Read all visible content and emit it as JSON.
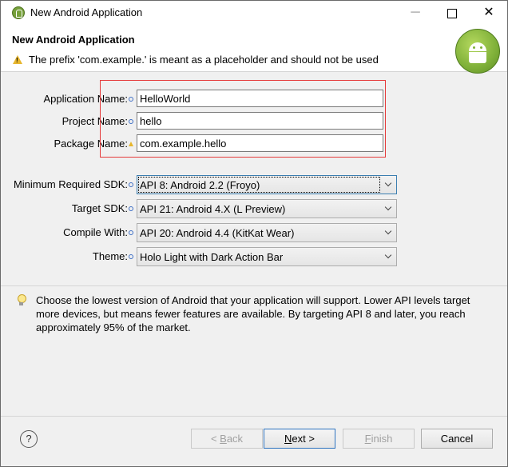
{
  "window": {
    "title": "New Android Application",
    "minimize": "─",
    "close": "✕"
  },
  "banner": {
    "title": "New Android Application",
    "message": "The prefix 'com.example.' is meant as a placeholder and should not be used"
  },
  "form": {
    "app_name": {
      "label": "Application Name:",
      "value": "HelloWorld"
    },
    "project_name": {
      "label": "Project Name:",
      "value": "hello"
    },
    "package_name": {
      "label": "Package Name:",
      "value": "com.example.hello"
    }
  },
  "sdk": {
    "min_sdk": {
      "label": "Minimum Required SDK:",
      "value": "API 8: Android 2.2 (Froyo)"
    },
    "target_sdk": {
      "label": "Target SDK:",
      "value": "API 21: Android 4.X (L Preview)"
    },
    "compile_with": {
      "label": "Compile With:",
      "value": "API 20: Android 4.4 (KitKat Wear)"
    },
    "theme": {
      "label": "Theme:",
      "value": "Holo Light with Dark Action Bar"
    }
  },
  "help": {
    "text": "Choose the lowest version of Android that your application will support. Lower API levels target more devices, but means fewer features are available. By targeting API 8 and later, you reach approximately 95% of the market."
  },
  "buttons": {
    "help": "?",
    "back_prefix": "< ",
    "back_underlined": "B",
    "back_rest": "ack",
    "next_underlined": "N",
    "next_rest": "ext >",
    "finish_underlined": "F",
    "finish_rest": "inish",
    "cancel": "Cancel"
  },
  "colors": {
    "highlight_box": "#e53b3b",
    "warning": "#e7b62d",
    "android_green": "#7fb039"
  },
  "icons": {
    "title": "android-app-icon",
    "warning": "warning-icon",
    "info": "info-icon",
    "hint": "lightbulb-icon",
    "help": "help-icon",
    "logo": "android-logo-icon"
  }
}
